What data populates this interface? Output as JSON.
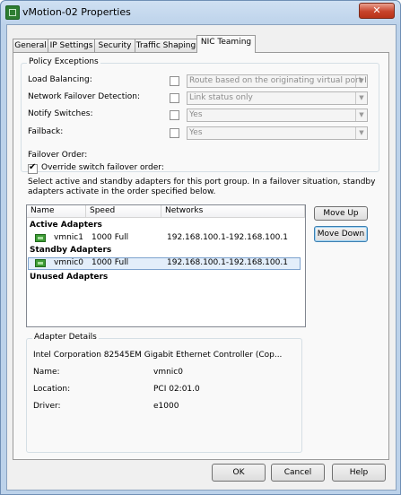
{
  "window": {
    "title": "vMotion-02 Properties",
    "close_label": "✕"
  },
  "tabs": [
    {
      "label": "General"
    },
    {
      "label": "IP Settings"
    },
    {
      "label": "Security"
    },
    {
      "label": "Traffic Shaping"
    },
    {
      "label": "NIC Teaming",
      "active": true
    }
  ],
  "policy": {
    "title": "Policy Exceptions",
    "rows": [
      {
        "label": "Load Balancing:",
        "checked": false,
        "value": "Route based on the originating virtual port ID"
      },
      {
        "label": "Network Failover Detection:",
        "checked": false,
        "value": "Link status only"
      },
      {
        "label": "Notify Switches:",
        "checked": false,
        "value": "Yes"
      },
      {
        "label": "Failback:",
        "checked": false,
        "value": "Yes"
      }
    ],
    "failover_order_label": "Failover Order:",
    "override_label": "Override switch failover order:",
    "override_checked": true,
    "description_line1": "Select active and standby adapters for this port group.  In a failover situation, standby",
    "description_line2": "adapters activate  in the order specified below."
  },
  "adapters": {
    "columns": [
      "Name",
      "Speed",
      "Networks"
    ],
    "active_header": "Active Adapters",
    "active": [
      {
        "name": "vmnic1",
        "speed": "1000 Full",
        "networks": "192.168.100.1-192.168.100.1"
      }
    ],
    "standby_header": "Standby Adapters",
    "standby": [
      {
        "name": "vmnic0",
        "speed": "1000 Full",
        "networks": "192.168.100.1-192.168.100.1",
        "selected": true
      }
    ],
    "unused_header": "Unused Adapters",
    "move_up_label": "Move Up",
    "move_down_label": "Move Down"
  },
  "details": {
    "title": "Adapter Details",
    "description": "Intel Corporation 82545EM Gigabit Ethernet Controller (Cop...",
    "name_label": "Name:",
    "name_value": "vmnic0",
    "location_label": "Location:",
    "location_value": "PCI 02:01.0",
    "driver_label": "Driver:",
    "driver_value": "e1000"
  },
  "footer": {
    "ok_label": "OK",
    "cancel_label": "Cancel",
    "help_label": "Help"
  }
}
